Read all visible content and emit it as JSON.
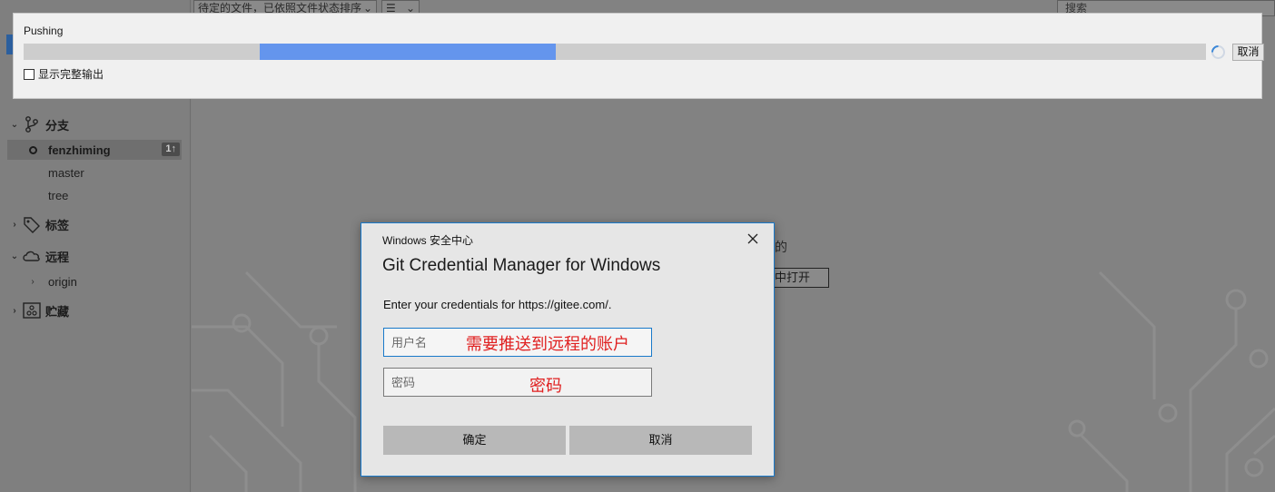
{
  "app": {
    "file_filter_label": "待定的文件，已依照文件状态排序",
    "view_menu_label": "☰",
    "search_placeholder": "搜索",
    "sidebar": {
      "branches_label": "分支",
      "branches": [
        {
          "name": "fenzhiming",
          "current": true,
          "ahead": "1↑"
        },
        {
          "name": "master"
        },
        {
          "name": "tree"
        }
      ],
      "tags_label": "标签",
      "remotes_label": "远程",
      "remotes": [
        {
          "name": "origin"
        }
      ],
      "stashes_label": "贮藏"
    },
    "main_text_line": "的",
    "open_in_button": "中打开"
  },
  "push_progress": {
    "title": "Pushing",
    "progress_start": 0.2,
    "progress_end": 0.45,
    "cancel_label": "取消",
    "show_full_output_label": "显示完整输出",
    "show_full_output_checked": false
  },
  "credential_dialog": {
    "caption": "Windows 安全中心",
    "title": "Git Credential Manager for Windows",
    "message": "Enter your credentials for https://gitee.com/.",
    "username_placeholder": "用户名",
    "username_annotation": "需要推送到远程的账户",
    "password_placeholder": "密码",
    "password_annotation": "密码",
    "ok_label": "确定",
    "cancel_label": "取消"
  },
  "colors": {
    "accent_blue": "#1979ca",
    "progress_fill": "#6495ed",
    "annotation_red": "#e02020"
  }
}
